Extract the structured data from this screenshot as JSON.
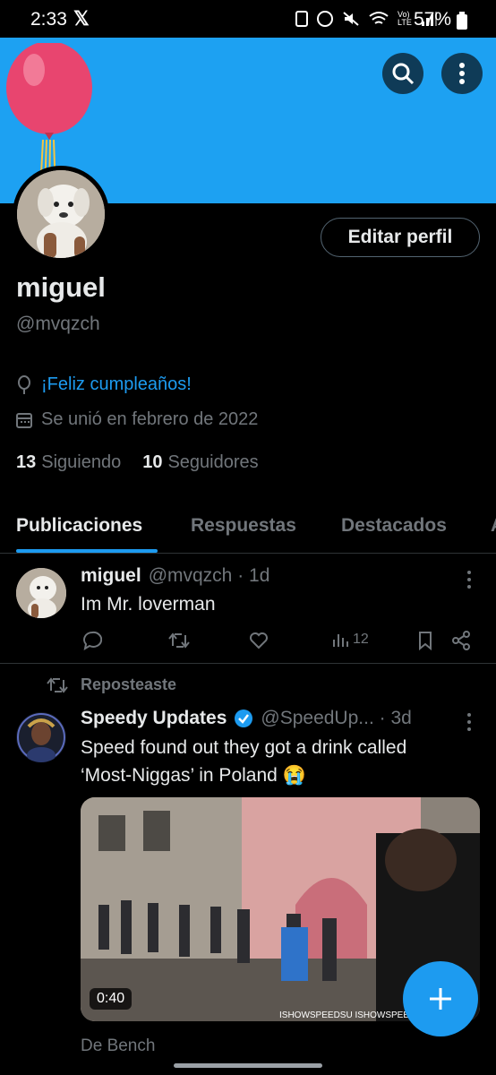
{
  "status": {
    "time": "2:33",
    "x_glyph": "𝕏",
    "battery": "57%"
  },
  "profile": {
    "name": "miguel",
    "handle": "@mvqzch",
    "edit_label": "Editar perfil",
    "birthday": "¡Feliz cumpleaños!",
    "joined": "Se unió en febrero de 2022",
    "following_count": "13",
    "following_label": "Siguiendo",
    "followers_count": "10",
    "followers_label": "Seguidores"
  },
  "tabs": [
    "Publicaciones",
    "Respuestas",
    "Destacados",
    "A"
  ],
  "post1": {
    "name": "miguel",
    "handle_time": "@mvqzch · 1d",
    "text": "Im Mr. loverman",
    "views": "12"
  },
  "post2": {
    "repost_label": "Reposteaste",
    "name": "Speedy Updates",
    "handle_time": "@SpeedUp... · 3d",
    "text_line1": "Speed found out they got a drink called",
    "text_line2": "‘Most-Niggas’ in Poland",
    "emoji": "😭",
    "duration": "0:40",
    "watermark": "ISHOWSPEEDSU  ISHOWSPEED",
    "source": "De Bench"
  },
  "colors": {
    "banner": "#1da1f2",
    "accent": "#1d9bf0",
    "muted": "#71767b"
  }
}
